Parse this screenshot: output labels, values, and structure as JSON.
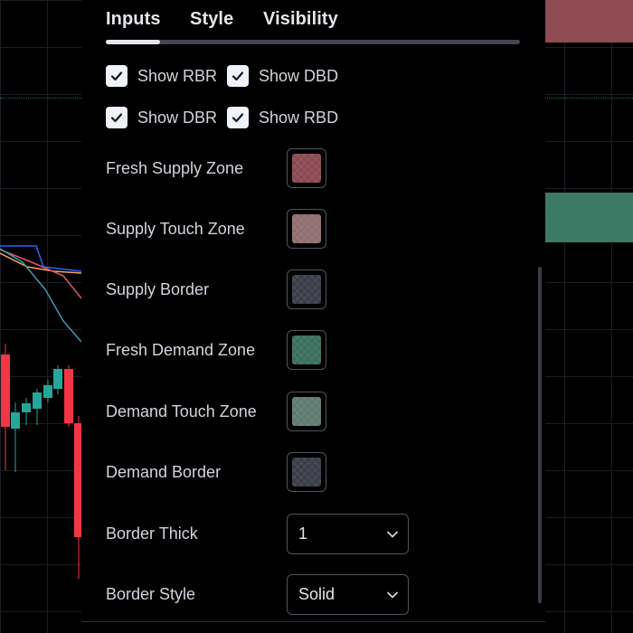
{
  "tabs": [
    {
      "label": "Inputs",
      "active": true
    },
    {
      "label": "Style",
      "active": false
    },
    {
      "label": "Visibility",
      "active": false
    }
  ],
  "checkboxes": [
    [
      {
        "label": "Show RBR",
        "checked": true
      },
      {
        "label": "Show DBD",
        "checked": true
      }
    ],
    [
      {
        "label": "Show DBR",
        "checked": true
      },
      {
        "label": "Show RBD",
        "checked": true
      }
    ]
  ],
  "colors": [
    {
      "label": "Fresh Supply Zone",
      "color": "#8a4a52"
    },
    {
      "label": "Supply Touch Zone",
      "color": "#8f6f70"
    },
    {
      "label": "Supply Border",
      "color": "#3a3d48"
    },
    {
      "label": "Fresh Demand Zone",
      "color": "#3b6e5e"
    },
    {
      "label": "Demand Touch Zone",
      "color": "#5f7a70"
    },
    {
      "label": "Demand Border",
      "color": "#3a3d48"
    }
  ],
  "selects": [
    {
      "label": "Border Thick",
      "value": "1"
    },
    {
      "label": "Border Style",
      "value": "Solid"
    }
  ],
  "theme": {
    "background": "#000000",
    "supply_zone_color": "#8f4a52",
    "demand_zone_color": "#3c7a66",
    "candle_up": "#26a69a",
    "candle_down": "#f23645"
  },
  "icons": {
    "checkbox_mark": "checkmark-icon",
    "select_arrow": "chevron-down-icon"
  }
}
